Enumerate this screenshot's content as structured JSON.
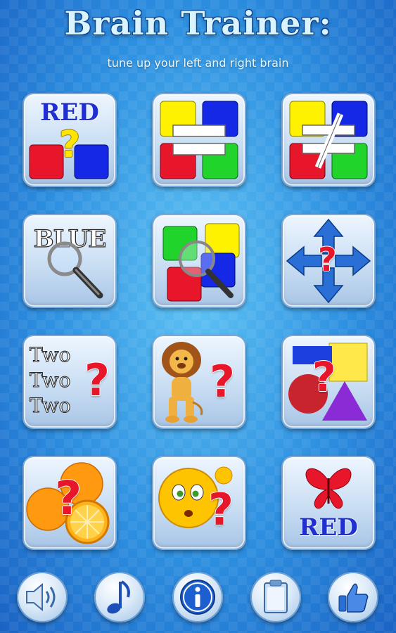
{
  "header": {
    "title": "Brain Trainer:",
    "subtitle": "tune up your left and right brain"
  },
  "tiles": {
    "color_word": {
      "word": "RED",
      "word_color": "#1f2fd0",
      "icon": "color-word-question-icon"
    },
    "match": {
      "icon": "color-squares-equal-icon"
    },
    "not_match": {
      "icon": "color-squares-not-equal-icon"
    },
    "word_search": {
      "word": "BLUE",
      "icon": "word-magnifier-icon"
    },
    "color_search": {
      "icon": "color-squares-magnifier-icon"
    },
    "direction": {
      "icon": "four-arrows-question-icon"
    },
    "count_words": {
      "words": [
        "Two",
        "Two",
        "Two"
      ],
      "icon": "words-question-icon"
    },
    "animal": {
      "icon": "lion-question-icon"
    },
    "shapes": {
      "icon": "shapes-question-icon"
    },
    "fruit": {
      "icon": "oranges-question-icon"
    },
    "emotion": {
      "icon": "emoji-question-icon"
    },
    "butterfly_word": {
      "word": "RED",
      "word_color": "#1f2fd0",
      "icon": "butterfly-word-icon"
    }
  },
  "bottom_bar": {
    "buttons": [
      "speaker-icon",
      "music-note-icon",
      "info-icon",
      "clipboard-icon",
      "thumbs-up-icon"
    ]
  },
  "colors": {
    "red": "#e8162a",
    "blue": "#1428e6",
    "yellow": "#fff200",
    "green": "#21d42b"
  }
}
